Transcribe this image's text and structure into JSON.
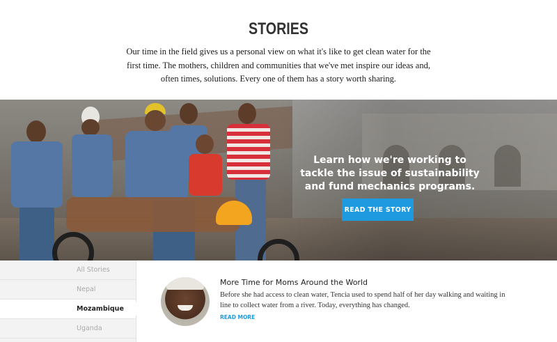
{
  "intro": {
    "title": "STORIES",
    "body": "Our time in the field gives us a personal view on what it's like to get clean water for the first time. The mothers, children and communities that we've met inspire our ideas and, often times, solutions. Every one of them has a story worth sharing."
  },
  "hero": {
    "headline": "Learn how we're working to tackle the issue of sustainability and fund mechanics programs.",
    "button_label": "READ THE STORY"
  },
  "sidebar": {
    "items": [
      {
        "label": "All Stories"
      },
      {
        "label": "Nepal"
      },
      {
        "label": "Mozambique"
      },
      {
        "label": "Uganda"
      }
    ],
    "active": "Mozambique"
  },
  "story": {
    "title": "More Time for Moms Around the World",
    "body": "Before she had access to clean water, Tencia used to spend half of her day walking and waiting in line to collect water from a river. Today, everything has changed.",
    "link": "READ MORE"
  },
  "colors": {
    "accent": "#1e9be0"
  }
}
